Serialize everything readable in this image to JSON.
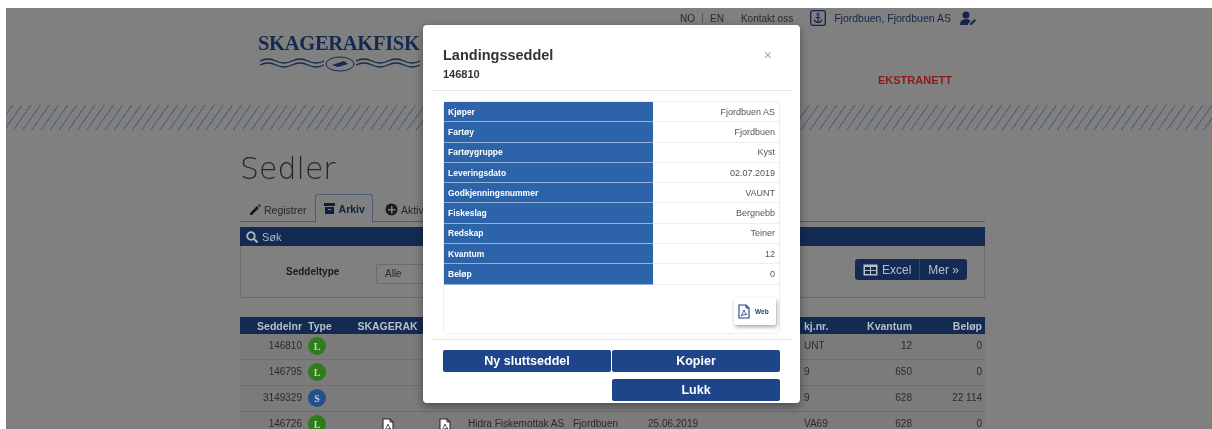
{
  "header": {
    "logo": "SKAGERAKFISK",
    "language_links": [
      {
        "label": "NO",
        "selected": false
      },
      {
        "label": "EN",
        "selected": false
      }
    ],
    "contact_link": "Kontakt oss",
    "account": "Fjordbuen, Fjordbuen AS",
    "section_label": "EKSTRANETT"
  },
  "page_title": "Sedler",
  "tabs": [
    {
      "label": "Registrer",
      "selected": false
    },
    {
      "label": "Arkiv",
      "selected": true
    },
    {
      "label": "Aktiv",
      "selected": false
    }
  ],
  "search": {
    "title": "Søk",
    "filter_label": "Seddeltype",
    "filter_value": "Alle",
    "buttons": [
      "Excel",
      "Mer »"
    ]
  },
  "table": {
    "columns": [
      "Seddelnr",
      "Type",
      "SKAGERAK",
      "kj.nr.",
      "Kvantum",
      "Beløp"
    ],
    "rows": [
      {
        "seddelnr": "146810",
        "type": {
          "letter": "L",
          "color": "#2e7d18"
        },
        "skagerak_pdf": false,
        "godkj": "UNT",
        "kvantum": "12",
        "belop": "0"
      },
      {
        "seddelnr": "146795",
        "type": {
          "letter": "L",
          "color": "#2e7d18"
        },
        "skagerak_pdf": false,
        "godkj": "9",
        "kvantum": "650",
        "belop": "0"
      },
      {
        "seddelnr": "3149329",
        "type": {
          "letter": "S",
          "color": "#23508c"
        },
        "skagerak_pdf": false,
        "godkj": "9",
        "kvantum": "628",
        "belop": "22 114"
      },
      {
        "seddelnr": "146726",
        "type": {
          "letter": "L",
          "color": "#2e7d18"
        },
        "skagerak_pdf": true,
        "pdf": true,
        "kjoper": "Hidra Fiskemottak AS",
        "fartoy": "Fjordbuen",
        "dato": "25.06.2019",
        "godkj": "VA69",
        "kvantum": "628",
        "belop": "0"
      }
    ]
  },
  "modal": {
    "title": "Landingsseddel",
    "subtitle": "146810",
    "close": "×",
    "details": [
      {
        "label": "Kjøper",
        "value": "Fjordbuen AS"
      },
      {
        "label": "Fartøy",
        "value": "Fjordbuen"
      },
      {
        "label": "Fartøygruppe",
        "value": "Kyst"
      },
      {
        "label": "Leveringsdato",
        "value": "02.07.2019"
      },
      {
        "label": "Godkjenningsnummer",
        "value": "VAUNT"
      },
      {
        "label": "Fiskeslag",
        "value": "Bergnebb"
      },
      {
        "label": "Redskap",
        "value": "Teiner"
      },
      {
        "label": "Kvantum",
        "value": "12"
      },
      {
        "label": "Beløp",
        "value": "0"
      }
    ],
    "web_button": "Web",
    "buttons": [
      "Ny sluttseddel",
      "Kopier",
      "Lukk"
    ]
  }
}
